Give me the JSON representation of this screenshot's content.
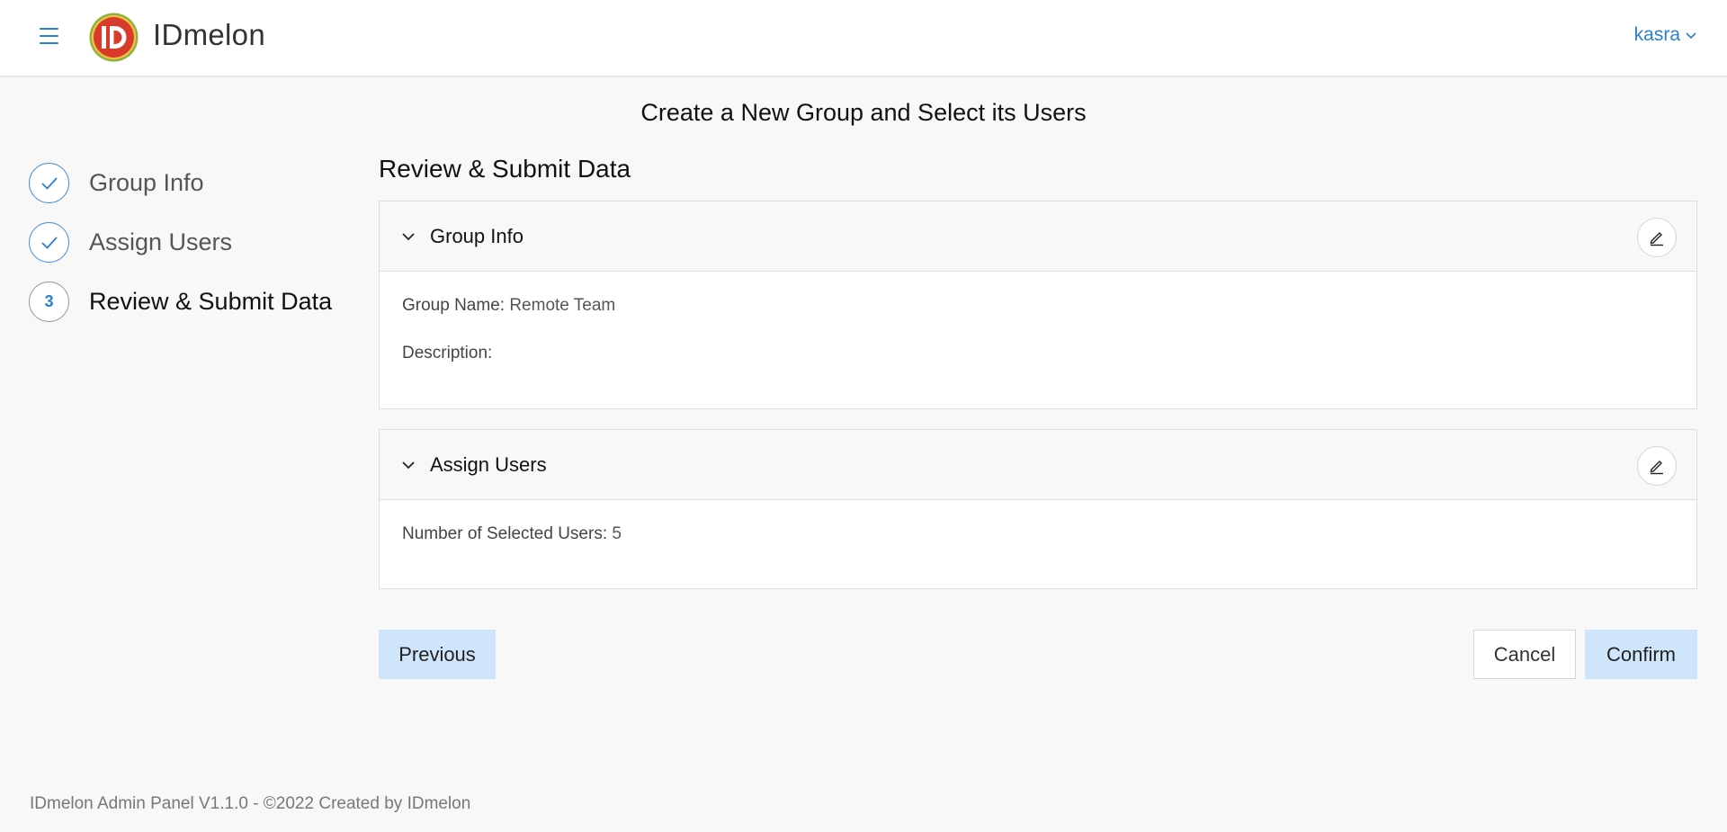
{
  "header": {
    "brand": "IDmelon",
    "user": "kasra",
    "logo_text": "ID"
  },
  "page": {
    "title": "Create a New Group and Select its Users"
  },
  "stepper": {
    "steps": [
      {
        "label": "Group Info",
        "state": "done"
      },
      {
        "label": "Assign Users",
        "state": "done"
      },
      {
        "label": "Review & Submit Data",
        "state": "current",
        "number": "3"
      }
    ]
  },
  "review": {
    "heading": "Review & Submit Data",
    "group_info": {
      "title": "Group Info",
      "group_name_label": "Group Name:",
      "group_name_value": "Remote Team",
      "description_label": "Description:",
      "description_value": ""
    },
    "assign_users": {
      "title": "Assign Users",
      "selected_label": "Number of Selected Users:",
      "selected_value": "5"
    }
  },
  "actions": {
    "previous": "Previous",
    "cancel": "Cancel",
    "confirm": "Confirm"
  },
  "footer": {
    "text": "IDmelon Admin Panel V1.1.0 - ©2022 Created by IDmelon"
  },
  "colors": {
    "accent": "#2b7fd0",
    "button_primary_bg": "#cfe5fb",
    "logo_red": "#d83b2b",
    "logo_ring": "#8ab43c"
  },
  "icons": {
    "menu": "hamburger-icon",
    "user_dropdown": "chevron-down-icon",
    "step_done": "check-icon",
    "panel_toggle": "chevron-down-icon",
    "edit": "pencil-icon"
  }
}
